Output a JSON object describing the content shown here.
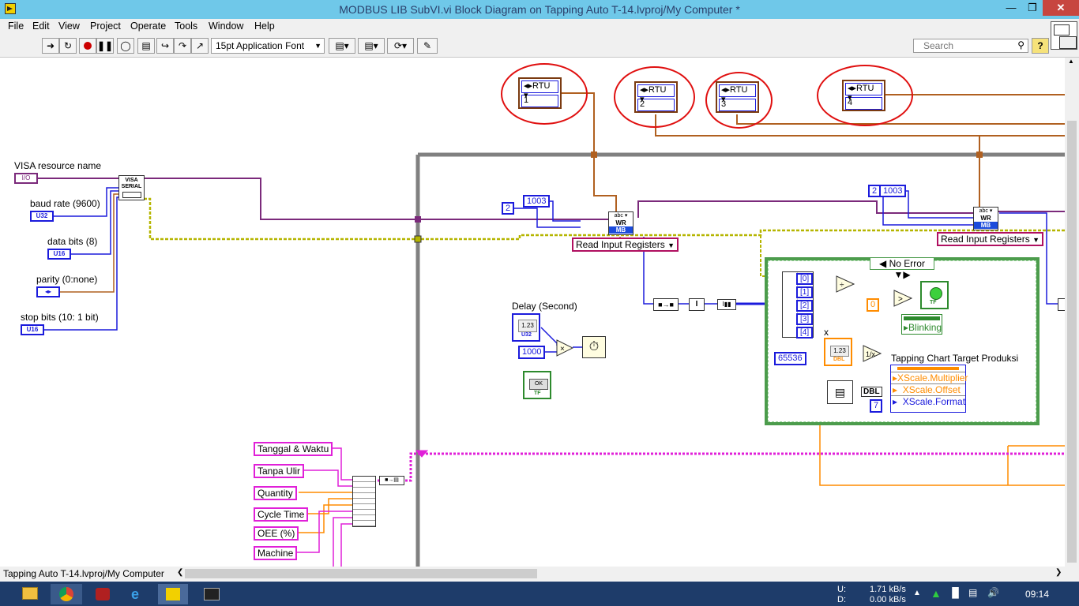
{
  "window": {
    "title": "MODBUS LIB SubVI.vi Block Diagram on Tapping Auto T-14.lvproj/My Computer *"
  },
  "menu": [
    "File",
    "Edit",
    "View",
    "Project",
    "Operate",
    "Tools",
    "Window",
    "Help"
  ],
  "toolbar": {
    "font_label": "15pt Application Font",
    "search_placeholder": "Search",
    "help_label": "?"
  },
  "diagram": {
    "rtu_constants": [
      {
        "mode": "RTU",
        "value": "1"
      },
      {
        "mode": "RTU",
        "value": "2"
      },
      {
        "mode": "RTU",
        "value": "3"
      },
      {
        "mode": "RTU",
        "value": "4"
      }
    ],
    "visa_resource_label": "VISA resource name",
    "visa_terminal": "I/O",
    "baud_label": "baud rate (9600)",
    "baud_type": "U32",
    "data_bits_label": "data bits (8)",
    "data_bits_type": "U16",
    "parity_label": "parity (0:none)",
    "stop_bits_label": "stop bits (10: 1 bit)",
    "stop_bits_type": "U16",
    "visa_node_text": "VISA SERIAL",
    "const_2a": "2",
    "const_1003a": "1003",
    "const_2b": "2",
    "const_1003b": "1003",
    "read_input_a": "Read Input Registers",
    "read_input_b": "Read Input Registers",
    "modbus_node": "WR",
    "modbus_sub": "MB",
    "delay_label": "Delay (Second)",
    "delay_type": "U32",
    "const_1000": "1000",
    "ok_button": "OK",
    "ok_type": "TF",
    "case_selector": "No Error",
    "index_items": [
      "[0]",
      "[1]",
      "[2]",
      "[3]",
      "[4]"
    ],
    "const_65536": "65536",
    "const_0": "0",
    "blinking_label": "Blinking",
    "x_label": "x",
    "x_type": "DBL",
    "chart_label": "Tapping Chart Target Produksi",
    "chart_props": [
      "XScale.Multiplier",
      "XScale.Offset",
      "XScale.Format"
    ],
    "dbl_label": "DBL",
    "const_7": "7",
    "cluster_labels": [
      "Tanggal & Waktu",
      "Tanpa  Ulir",
      "Quantity",
      "Cycle Time",
      "OEE (%)",
      "Machine"
    ]
  },
  "statusbar": {
    "project": "Tapping Auto T-14.lvproj/My Computer"
  },
  "taskbar": {
    "upload_label": "U:",
    "download_label": "D:",
    "upload_rate": "1.71 kB/s",
    "download_rate": "0.00 kB/s",
    "clock": "09:14"
  },
  "colors": {
    "titlebar": "#6fc8e9",
    "wire_visa": "#7b2a7b",
    "wire_error": "#b5b500",
    "wire_int": "#1b1bdc",
    "wire_enum": "#b06020",
    "wire_string": "#e020d8",
    "wire_dbl": "#ff8c00",
    "annotation_ring": "#e01010",
    "case_border": "#4c9c4c"
  }
}
